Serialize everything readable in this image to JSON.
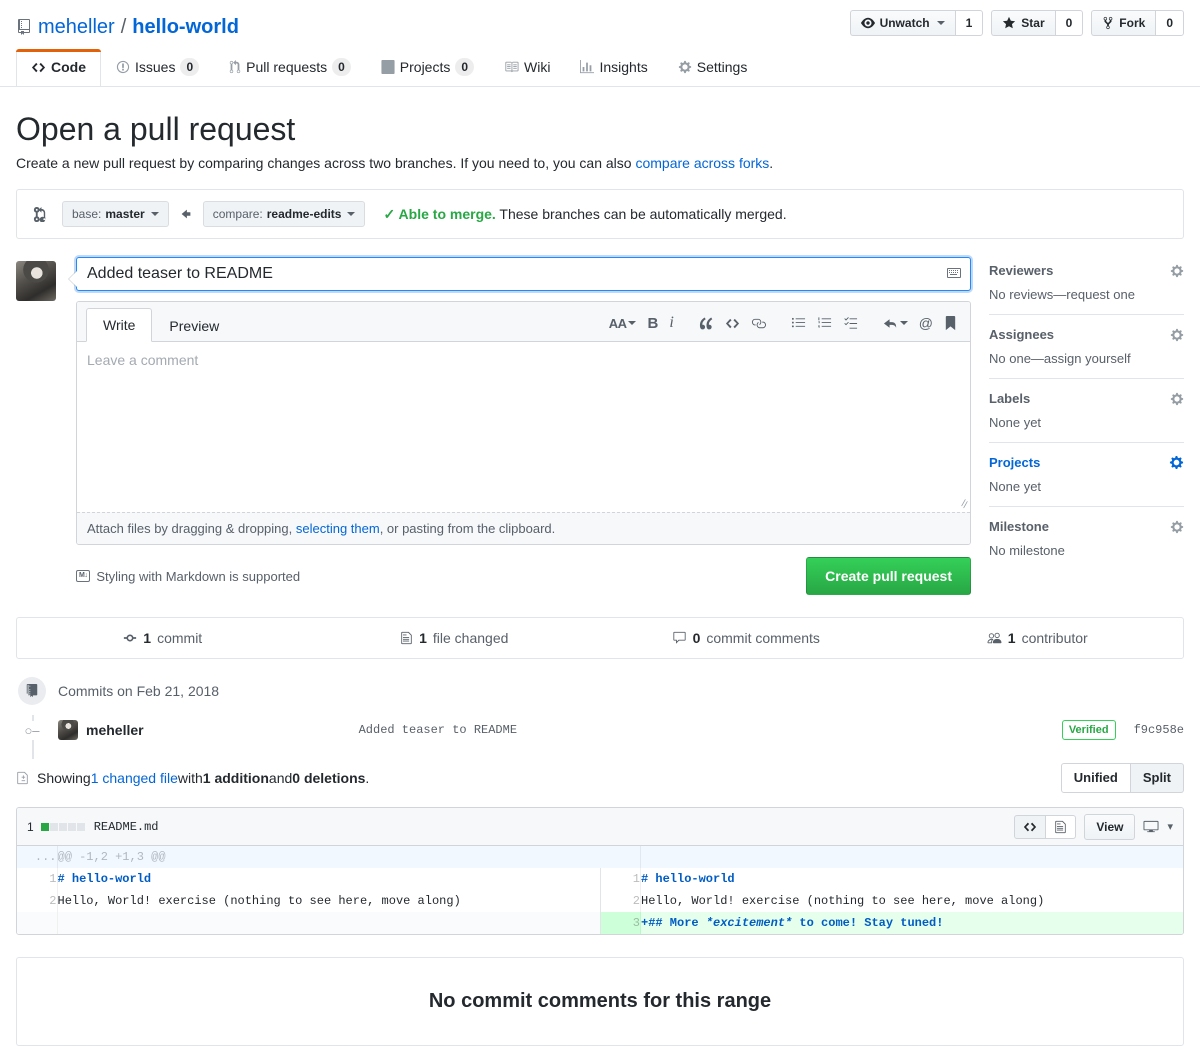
{
  "header": {
    "owner": "meheller",
    "separator": "/",
    "repo": "hello-world",
    "actions": [
      {
        "label": "Unwatch",
        "count": "1",
        "icon": "eye-icon",
        "has_caret": true
      },
      {
        "label": "Star",
        "count": "0",
        "icon": "star-icon",
        "has_caret": false
      },
      {
        "label": "Fork",
        "count": "0",
        "icon": "fork-icon",
        "has_caret": false
      }
    ],
    "nav": [
      {
        "label": "Code",
        "count": null,
        "icon": "code-icon",
        "selected": true
      },
      {
        "label": "Issues",
        "count": "0",
        "icon": "issue-opened-icon",
        "selected": false
      },
      {
        "label": "Pull requests",
        "count": "0",
        "icon": "git-pull-request-icon",
        "selected": false
      },
      {
        "label": "Projects",
        "count": "0",
        "icon": "project-icon",
        "selected": false
      },
      {
        "label": "Wiki",
        "count": null,
        "icon": "book-icon",
        "selected": false
      },
      {
        "label": "Insights",
        "count": null,
        "icon": "graph-icon",
        "selected": false
      },
      {
        "label": "Settings",
        "count": null,
        "icon": "gear-icon",
        "selected": false
      }
    ]
  },
  "page": {
    "title": "Open a pull request",
    "subtitle_before": "Create a new pull request by comparing changes across two branches. If you need to, you can also ",
    "subtitle_link": "compare across forks",
    "subtitle_after": "."
  },
  "compare": {
    "base_prefix": "base: ",
    "base_branch": "master",
    "compare_prefix": "compare: ",
    "compare_branch": "readme-edits",
    "status_ok": "✓ Able to merge.",
    "status_rest": " These branches can be automatically merged."
  },
  "form": {
    "title_value": "Added teaser to README",
    "title_placeholder": "Title",
    "tabs": [
      {
        "label": "Write",
        "active": true
      },
      {
        "label": "Preview",
        "active": false
      }
    ],
    "toolbar": [
      {
        "name": "heading-icon",
        "glyph": "AA"
      },
      {
        "name": "bold-icon",
        "glyph": "B"
      },
      {
        "name": "italic-icon",
        "glyph": "i"
      },
      {
        "name": "quote-icon",
        "glyph": "“"
      },
      {
        "name": "code-icon",
        "glyph": "<>"
      },
      {
        "name": "link-icon",
        "glyph": "⚭"
      },
      {
        "name": "unordered-list-icon",
        "glyph": "☰"
      },
      {
        "name": "ordered-list-icon",
        "glyph": "☰"
      },
      {
        "name": "task-list-icon",
        "glyph": "✓☰"
      },
      {
        "name": "reply-icon",
        "glyph": "↩"
      },
      {
        "name": "mention-icon",
        "glyph": "@"
      },
      {
        "name": "saved-replies-icon",
        "glyph": "⚑"
      }
    ],
    "comment_placeholder": "Leave a comment",
    "comment_value": "",
    "attach_before": "Attach files by dragging & dropping, ",
    "attach_link": "selecting them",
    "attach_after": ", or pasting from the clipboard.",
    "markdown_note": "Styling with Markdown is supported",
    "markdown_badge": "M↓",
    "submit_label": "Create pull request"
  },
  "sidebar": [
    {
      "title": "Reviewers",
      "body": "No reviews—request one",
      "highlighted": false
    },
    {
      "title": "Assignees",
      "body": "No one—assign yourself",
      "highlighted": false
    },
    {
      "title": "Labels",
      "body": "None yet",
      "highlighted": false
    },
    {
      "title": "Projects",
      "body": "None yet",
      "highlighted": true
    },
    {
      "title": "Milestone",
      "body": "No milestone",
      "highlighted": false
    }
  ],
  "stats": [
    {
      "icon": "commit-icon",
      "count": "1",
      "label": "commit"
    },
    {
      "icon": "file-icon",
      "count": "1",
      "label": "file changed"
    },
    {
      "icon": "comment-icon",
      "count": "0",
      "label": "commit comments"
    },
    {
      "icon": "people-icon",
      "count": "1",
      "label": "contributor"
    }
  ],
  "commits": {
    "day_header": "Commits on Feb 21, 2018",
    "rows": [
      {
        "author": "meheller",
        "message": "Added teaser to README",
        "verified": "Verified",
        "sha": "f9c958e"
      }
    ]
  },
  "diff_summary": {
    "showing": "Showing ",
    "file_link": "1 changed file",
    "with": " with ",
    "additions": "1 addition",
    "and": " and ",
    "deletions": "0 deletions",
    "period": ".",
    "view_modes": [
      {
        "label": "Unified",
        "active": false
      },
      {
        "label": "Split",
        "active": true
      }
    ]
  },
  "file": {
    "diffstat_count": "1",
    "diffstat_blocks": [
      "add",
      "neutral",
      "neutral",
      "neutral",
      "neutral"
    ],
    "name": "README.md",
    "view_button": "View",
    "hunk_header": "@@ -1,2 +1,3 @@",
    "hunk_ellipsis": "...",
    "left_lines": [
      {
        "num": "1",
        "text": "# hello-world",
        "type": "heading"
      },
      {
        "num": "2",
        "text": "Hello, World! exercise (nothing to see here, move along)",
        "type": "context"
      },
      {
        "num": "",
        "text": "",
        "type": "empty"
      }
    ],
    "right_lines": [
      {
        "num": "1",
        "text": "# hello-world",
        "type": "heading"
      },
      {
        "num": "2",
        "text": "Hello, World! exercise (nothing to see here, move along)",
        "type": "context"
      },
      {
        "num": "3",
        "text": "+## More *excitement* to come! Stay tuned!",
        "type": "added",
        "prefix": "+## More ",
        "italic": "*excitement*",
        "suffix": " to come! Stay tuned!"
      }
    ]
  },
  "no_comments": "No commit comments for this range",
  "colors": {
    "accent": "#0366d6",
    "green": "#28a745",
    "orange": "#e36209",
    "border": "#e1e4e8"
  }
}
